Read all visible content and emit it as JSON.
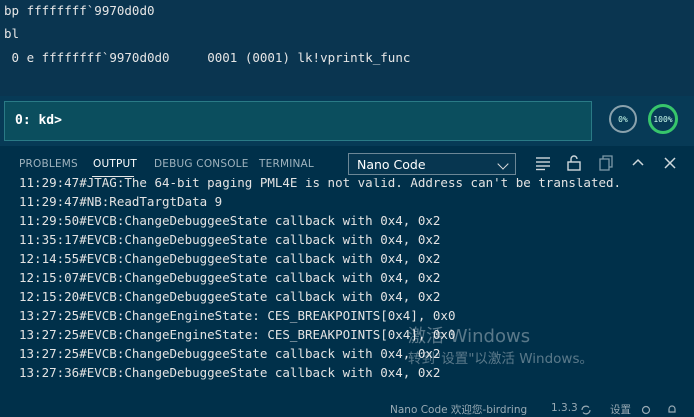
{
  "debugger": {
    "lines": [
      "bp ffffffff`9970d0d0",
      "bl",
      " 0 e ffffffff`9970d0d0     0001 (0001) lk!vprintk_func"
    ],
    "prompt": "0: kd>",
    "gauges": [
      {
        "label": "0%",
        "value": 0
      },
      {
        "label": "100%",
        "value": 100
      }
    ]
  },
  "panel": {
    "tabs": [
      {
        "label": "PROBLEMS",
        "active": false
      },
      {
        "label": "OUTPUT",
        "active": true
      },
      {
        "label": "DEBUG CONSOLE",
        "active": false
      },
      {
        "label": "TERMINAL",
        "active": false
      }
    ],
    "channel": "Nano Code",
    "tool_icons": [
      "list-filter-icon",
      "lock-icon",
      "copy-icon",
      "chevron-up-icon",
      "close-icon"
    ]
  },
  "output": {
    "lines": [
      "11:29:47#JTAG:The 64-bit paging PML4E is not valid. Address can't be translated.",
      "11:29:47#NB:ReadTargtData 9",
      "11:29:50#EVCB:ChangeDebuggeeState callback with 0x4, 0x2",
      "11:35:17#EVCB:ChangeDebuggeeState callback with 0x4, 0x2",
      "12:14:55#EVCB:ChangeDebuggeeState callback with 0x4, 0x2",
      "12:15:07#EVCB:ChangeDebuggeeState callback with 0x4, 0x2",
      "12:15:20#EVCB:ChangeDebuggeeState callback with 0x4, 0x2",
      "13:27:25#EVCB:ChangeEngineState: CES_BREAKPOINTS[0x4], 0x0",
      "13:27:25#EVCB:ChangeEngineState: CES_BREAKPOINTS[0x4], 0x0",
      "13:27:25#EVCB:ChangeDebuggeeState callback with 0x4, 0x2",
      "13:27:36#EVCB:ChangeDebuggeeState callback with 0x4, 0x2"
    ]
  },
  "watermark": {
    "title": "激活 Windows",
    "subtitle": "转到\"设置\"以激活 Windows。"
  },
  "statusbar": {
    "left": "Nano Code 欢迎您-birdring",
    "version": "1.3.3",
    "settings": "设置"
  }
}
